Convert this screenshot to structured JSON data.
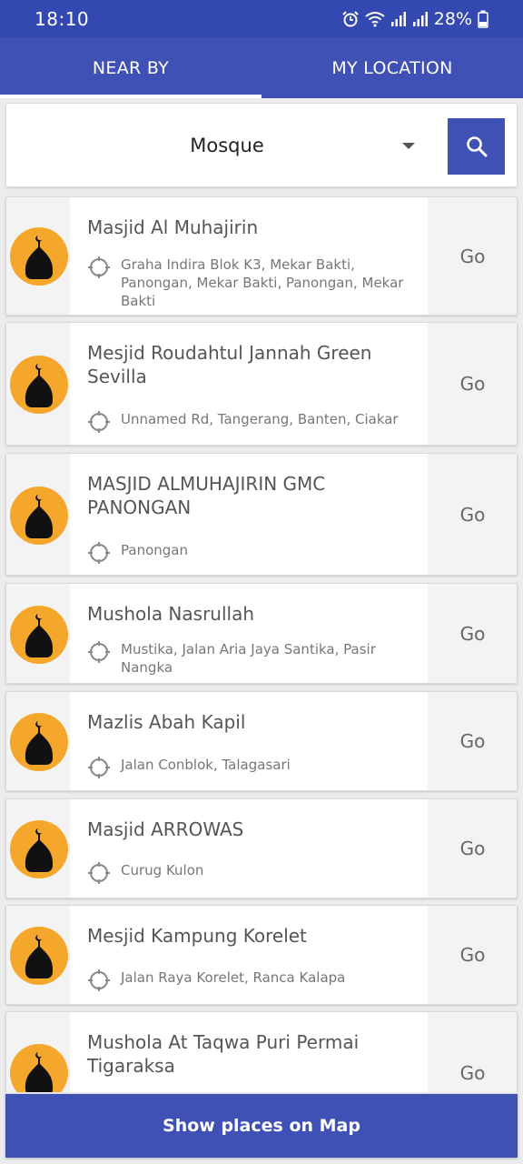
{
  "status_bar": {
    "time": "18:10",
    "battery": "28%",
    "icons": [
      "alarm-icon",
      "wifi-icon",
      "signal-icon",
      "signal-icon",
      "battery-icon"
    ]
  },
  "tabs": [
    {
      "label": "NEAR BY",
      "active": true
    },
    {
      "label": "MY LOCATION",
      "active": false
    }
  ],
  "search": {
    "category": "Mosque",
    "button_icon": "search-icon"
  },
  "places": [
    {
      "name": "Masjid Al Muhajirin",
      "address": "Graha Indira Blok K3, Mekar Bakti, Panongan, Mekar Bakti, Panongan, Mekar Bakti",
      "go": "Go"
    },
    {
      "name": "Mesjid Roudahtul Jannah Green Sevilla",
      "address": "Unnamed Rd, Tangerang, Banten, Ciakar",
      "go": "Go"
    },
    {
      "name": "MASJID ALMUHAJIRIN GMC PANONGAN",
      "address": "Panongan",
      "go": "Go"
    },
    {
      "name": "Mushola Nasrullah",
      "address": "Mustika, Jalan Aria Jaya Santika, Pasir Nangka",
      "go": "Go"
    },
    {
      "name": "Mazlis Abah Kapil",
      "address": "Jalan Conblok, Talagasari",
      "go": "Go"
    },
    {
      "name": "Masjid ARROWAS",
      "address": "Curug Kulon",
      "go": "Go"
    },
    {
      "name": "Mesjid Kampung Korelet",
      "address": "Jalan Raya Korelet, Ranca Kalapa",
      "go": "Go"
    },
    {
      "name": "Mushola At Taqwa Puri Permai Tigaraksa",
      "address": "",
      "go": "Go"
    }
  ],
  "show_map_label": "Show places on Map",
  "colors": {
    "primary": "#3f51b5",
    "status_bar": "#3448b1",
    "avatar": "#f4a72a"
  }
}
